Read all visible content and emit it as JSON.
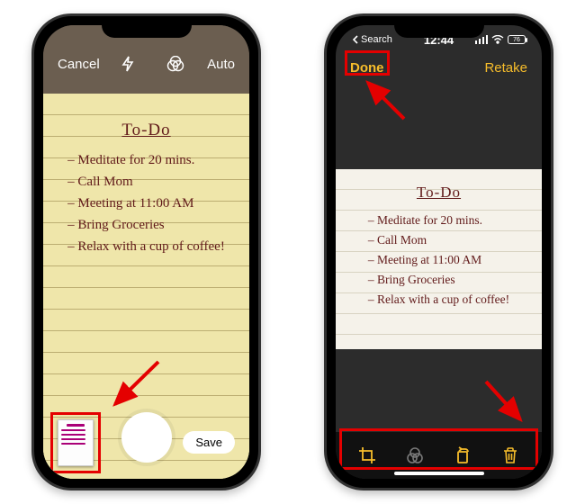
{
  "left": {
    "cancel": "Cancel",
    "auto": "Auto",
    "save": "Save",
    "note": {
      "title": "To-Do",
      "items": [
        "Meditate for 20 mins.",
        "Call Mom",
        "Meeting at 11:00 AM",
        "Bring Groceries",
        "Relax with a cup of coffee!"
      ]
    }
  },
  "right": {
    "status": {
      "back_label": "Search",
      "time": "12:44",
      "battery": "76"
    },
    "done": "Done",
    "retake": "Retake",
    "note": {
      "title": "To-Do",
      "items": [
        "Meditate for 20 mins.",
        "Call Mom",
        "Meeting at 11:00 AM",
        "Bring Groceries",
        "Relax with a cup of coffee!"
      ]
    },
    "tools": [
      "crop",
      "filter",
      "rotate",
      "delete"
    ]
  },
  "colors": {
    "accent": "#f7bd2b",
    "callout": "#e40000"
  }
}
